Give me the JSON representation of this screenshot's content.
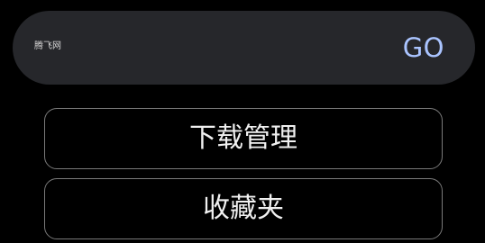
{
  "search": {
    "value": "腾飞网",
    "go_label": "GO"
  },
  "menu": {
    "items": [
      {
        "label": "下载管理"
      },
      {
        "label": "收藏夹"
      }
    ]
  },
  "colors": {
    "background": "#000000",
    "search_bar": "#26272b",
    "go_accent": "#aac4ff",
    "button_border": "#7a7a7a",
    "text": "#f0f0f0"
  }
}
